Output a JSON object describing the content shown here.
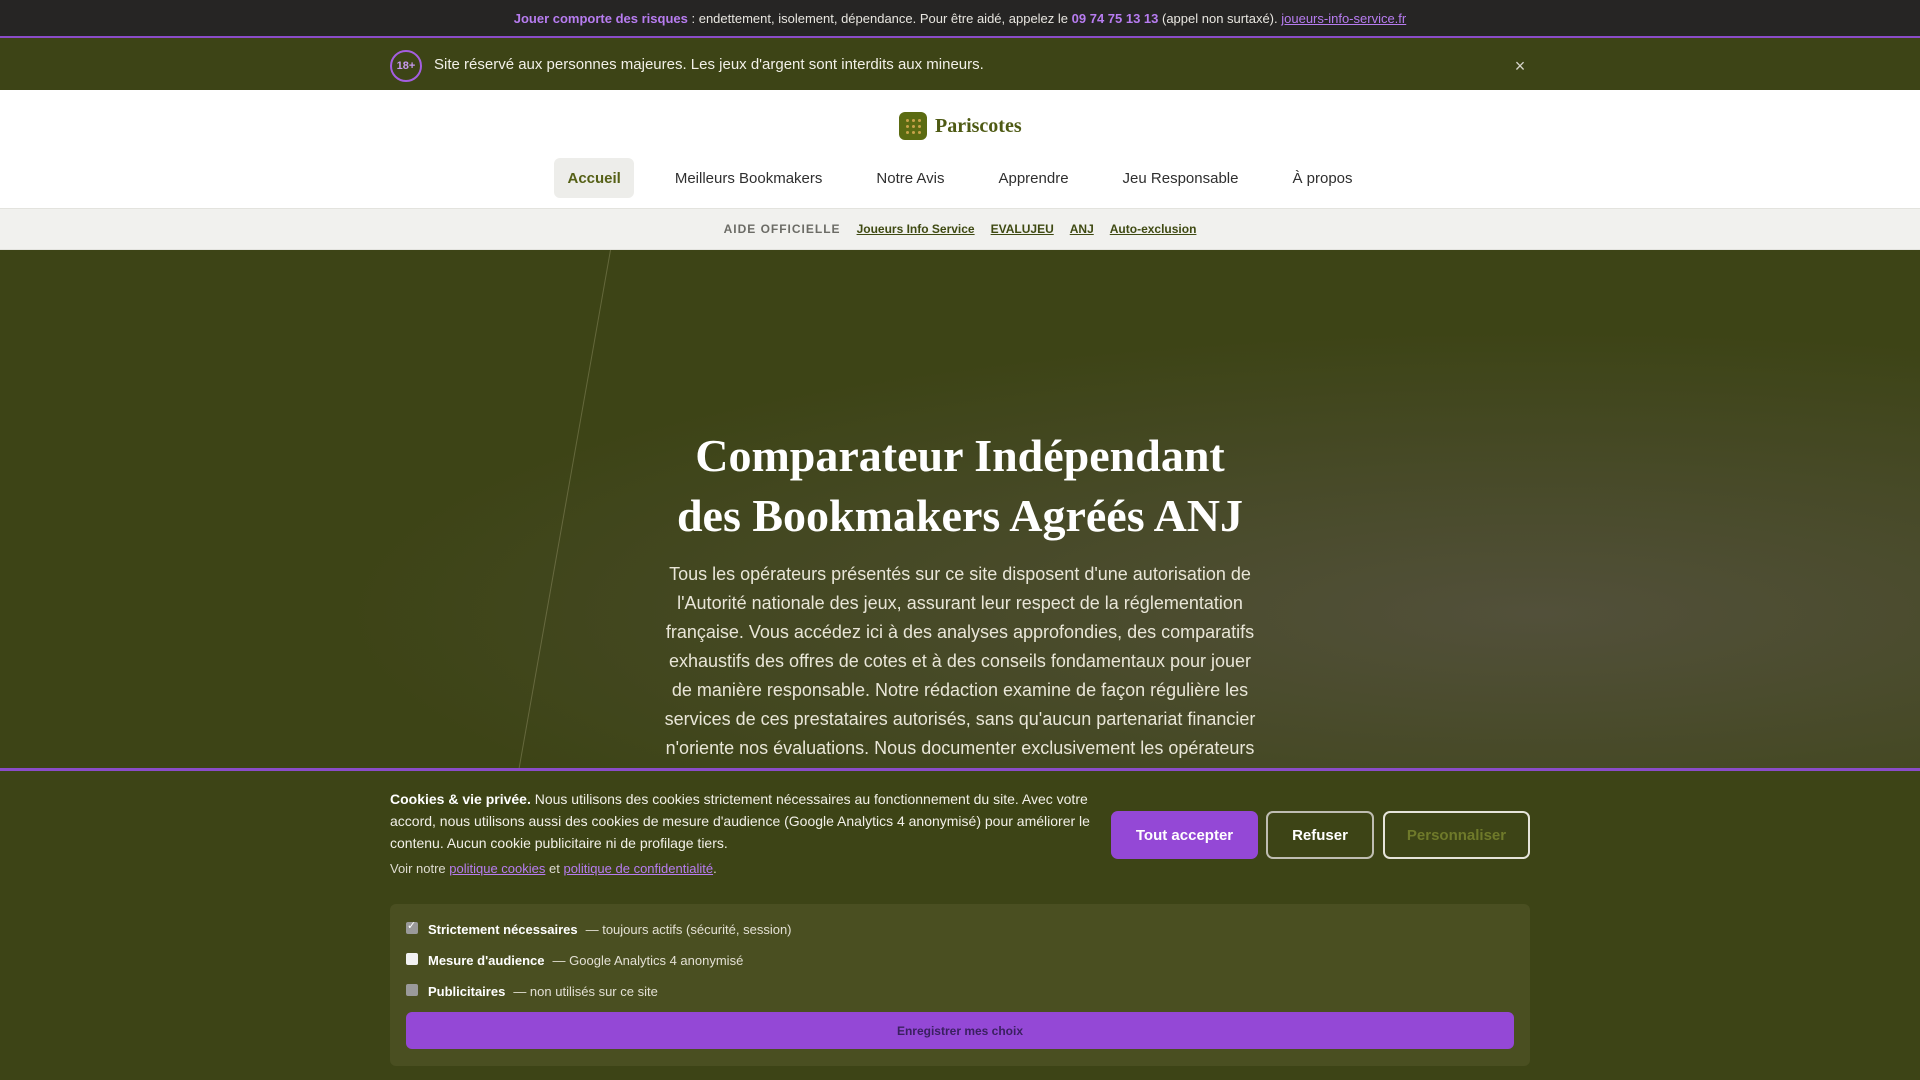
{
  "risk_bar": {
    "label": "Jouer comporte des risques",
    "text1": " : endettement, isolement, dépendance. Pour être aidé, appelez le ",
    "phone": "09 74 75 13 13",
    "text2": " (appel non surtaxé). ",
    "link": "joueurs-info-service.fr"
  },
  "age_bar": {
    "badge": "18+",
    "text": "Site réservé aux personnes majeures. Les jeux d'argent sont interdits aux mineurs.",
    "close": "×"
  },
  "header": {
    "logo_text": "Pariscotes",
    "nav": [
      "Accueil",
      "Meilleurs Bookmakers",
      "Notre Avis",
      "Apprendre",
      "Jeu Responsable",
      "À propos"
    ]
  },
  "help_bar": {
    "label": "AIDE OFFICIELLE",
    "links": [
      "Joueurs Info Service",
      "EVALUJEU",
      "ANJ",
      "Auto-exclusion"
    ]
  },
  "hero": {
    "title": "Comparateur Indépendant des Bookmakers Agréés ANJ",
    "text": "Tous les opérateurs présentés sur ce site disposent d'une autorisation de l'Autorité nationale des jeux, assurant leur respect de la réglementation française. Vous accédez ici à des analyses approfondies, des comparatifs exhaustifs des offres de cotes et à des conseils fondamentaux pour jouer de manière responsable. Notre rédaction examine de façon régulière les services de ces prestataires autorisés, sans qu'aucun partenariat financier n'oriente nos évaluations. Nous documenter exclusivement les opérateurs"
  },
  "cookie": {
    "title": "Cookies & vie privée.",
    "text": " Nous utilisons des cookies strictement nécessaires au fonctionnement du site. Avec votre accord, nous utilisons aussi des cookies de mesure d'audience (Google Analytics 4 anonymisé) pour améliorer le contenu. Aucun cookie publicitaire ni de profilage tiers.",
    "policy_prefix": "Voir notre ",
    "policy_link1": "politique cookies",
    "policy_mid": " et ",
    "policy_link2": "politique de confidentialité",
    "policy_suffix": ".",
    "buttons": {
      "accept": "Tout accepter",
      "refuse": "Refuser",
      "customize": "Personnaliser"
    },
    "prefs": [
      {
        "label": "Strictement nécessaires",
        "desc": "— toujours actifs (sécurité, session)"
      },
      {
        "label": "Mesure d'audience",
        "desc": "— Google Analytics 4 anonymisé"
      },
      {
        "label": "Publicitaires",
        "desc": "— non utilisés sur ce site"
      }
    ],
    "save": "Enregistrer mes choix"
  },
  "colors": {
    "olive": "#3d4416",
    "purple": "#9448d6",
    "dark": "#262524"
  }
}
